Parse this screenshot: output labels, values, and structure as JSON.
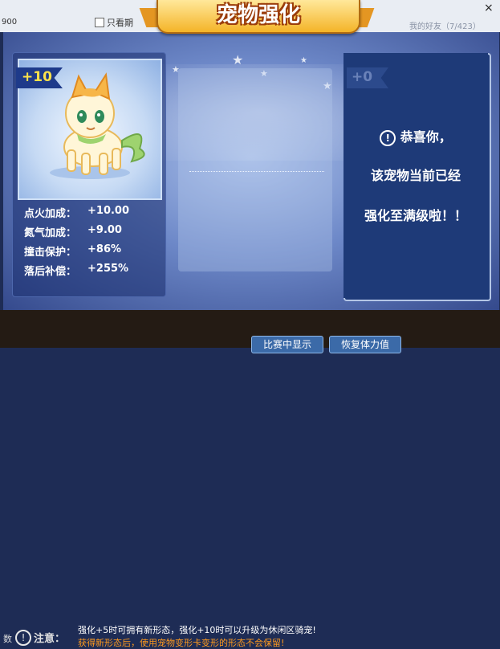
{
  "window": {
    "left_text": "900",
    "checkbox_label": "只看期",
    "friends_label": "我的好友（7/423）",
    "close_glyph": "×"
  },
  "header": {
    "title": "宠物强化"
  },
  "pet_card": {
    "level_tag": "+10",
    "stats": [
      {
        "label": "点火加成：",
        "value": "+10.00"
      },
      {
        "label": "氮气加成：",
        "value": "+9.00"
      },
      {
        "label": "撞击保护：",
        "value": "+86%"
      },
      {
        "label": "落后补偿：",
        "value": "+255%"
      }
    ]
  },
  "result_card": {
    "level_tag": "+0",
    "line1": "恭喜你，",
    "line2": "该宠物当前已经",
    "line3": "强化至满级啦！！"
  },
  "notice": {
    "label": "注意：",
    "line1": "强化+5时可拥有新形态，强化+10时可以升级为休闲区骑宠!",
    "line2": "获得新形态后，使用宠物变形卡变形的形态不会保留!",
    "left_word": "数"
  },
  "bottom_buttons": [
    "比赛中显示",
    "恢复体力值"
  ],
  "colors": {
    "accent_gold": "#f4b428",
    "stat_value_yellow": "#ffe24a",
    "warning_orange": "#ff9a1e"
  }
}
